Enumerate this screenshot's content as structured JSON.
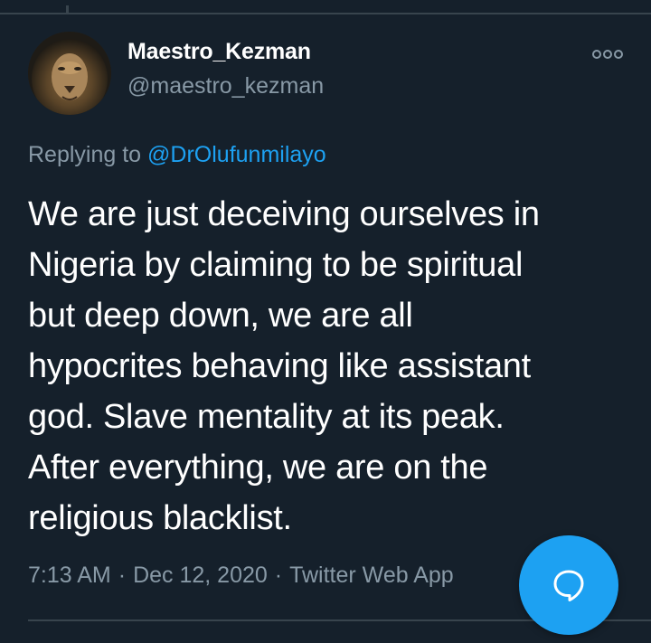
{
  "colors": {
    "background": "#15202b",
    "text_primary": "#ffffff",
    "text_secondary": "#8899a6",
    "accent": "#1da1f2",
    "divider": "#38444d"
  },
  "tweet": {
    "author": {
      "display_name": "Maestro_Kezman",
      "handle": "@maestro_kezman",
      "avatar_icon": "lion-avatar"
    },
    "more_icon": "more-options-icon",
    "replying_to": {
      "prefix": "Replying to",
      "mention": "@DrOlufunmilayo"
    },
    "text_lines": [
      "We are just deceiving ourselves in",
      "Nigeria by claiming to be spiritual",
      "but deep down, we are all",
      "hypocrites behaving like assistant",
      "god. Slave mentality at its peak.",
      "After everything, we are on the",
      "religious blacklist."
    ],
    "time": "7:13 AM",
    "separator": "·",
    "date": "Dec 12, 2020",
    "source": "Twitter Web App"
  },
  "fab": {
    "icon": "reply-bubble-icon"
  }
}
